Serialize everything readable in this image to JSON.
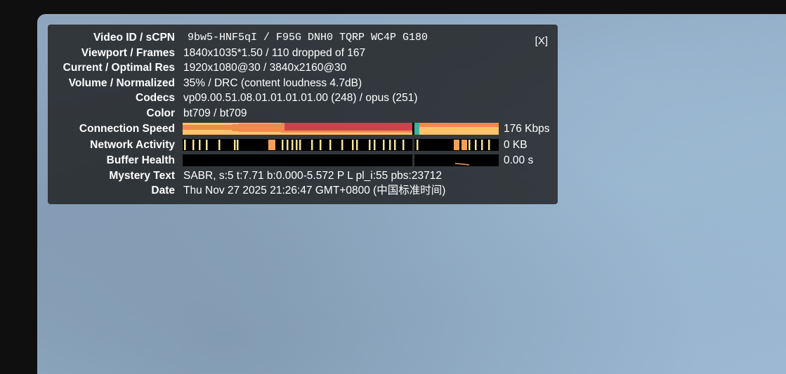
{
  "stats": {
    "close_label": "[X]",
    "rows": [
      {
        "label": "Video ID / sCPN",
        "value": "9bw5-HNF5qI / F95G DNH0 TQRP WC4P G180"
      },
      {
        "label": "Viewport / Frames",
        "value": "1840x1035*1.50 / 110 dropped of 167"
      },
      {
        "label": "Current / Optimal Res",
        "value": "1920x1080@30 / 3840x2160@30"
      },
      {
        "label": "Volume / Normalized",
        "value": "35% / DRC (content loudness 4.7dB)"
      },
      {
        "label": "Codecs",
        "value": "vp09.00.51.08.01.01.01.01.00 (248) / opus (251)"
      },
      {
        "label": "Color",
        "value": "bt709 / bt709"
      },
      {
        "label": "Connection Speed",
        "value": "176 Kbps"
      },
      {
        "label": "Network Activity",
        "value": "0 KB"
      },
      {
        "label": "Buffer Health",
        "value": "0.00 s"
      },
      {
        "label": "Mystery Text",
        "value": "SABR, s:5 t:7.71 b:0.000-5.572 P L pl_i:55 pbs:23712"
      },
      {
        "label": "Date",
        "value": "Thu Nov 27 2025 21:26:47 GMT+0800 (中国标准时间)"
      }
    ]
  },
  "colors": {
    "speed_light": "#ffc36b",
    "speed_mid": "#f08a4b",
    "speed_dark": "#d2404e",
    "speed_accent": "#3bb39b",
    "activity_bar": "#f5e39a",
    "activity_orange": "#f5a05a",
    "buffer_line": "#f5a05a"
  }
}
